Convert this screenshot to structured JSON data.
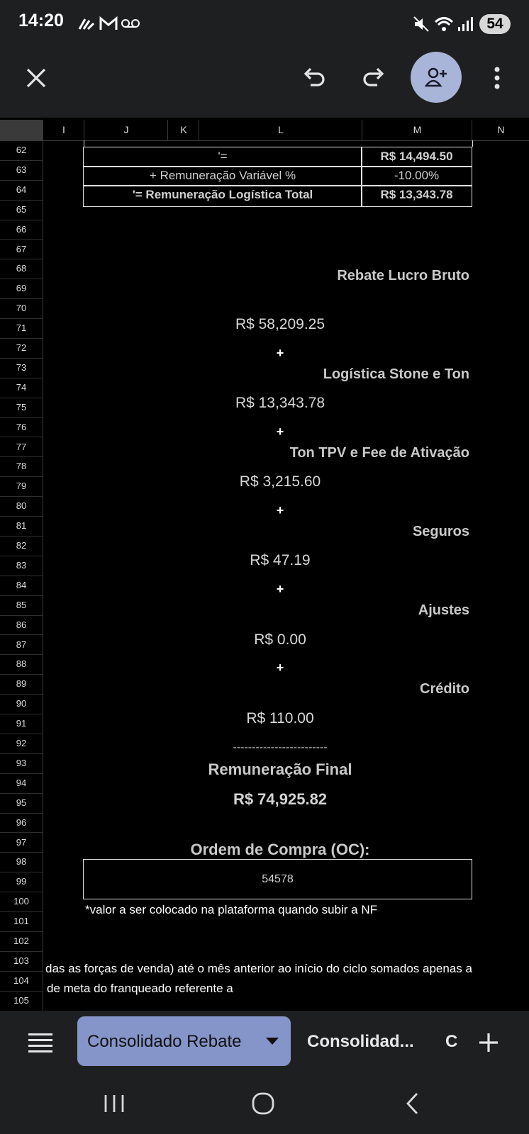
{
  "status_bar": {
    "time": "14:20",
    "left_icons": [
      "signal-app-icon",
      "gmail-icon",
      "voicemail-icon"
    ],
    "right_icons": [
      "mute-icon",
      "wifi-icon",
      "cell-signal-icon"
    ],
    "battery": "54"
  },
  "toolbar": {
    "close_icon": "close-icon",
    "undo_icon": "undo-icon",
    "redo_icon": "redo-icon",
    "share_icon": "add-person-icon",
    "more_icon": "more-vert-icon"
  },
  "columns": [
    "I",
    "J",
    "K",
    "L",
    "M",
    "N"
  ],
  "rows": [
    "62",
    "63",
    "64",
    "65",
    "66",
    "67",
    "68",
    "69",
    "70",
    "71",
    "72",
    "73",
    "74",
    "75",
    "76",
    "77",
    "78",
    "79",
    "80",
    "81",
    "82",
    "83",
    "84",
    "85",
    "86",
    "87",
    "88",
    "89",
    "90",
    "91",
    "92",
    "93",
    "94",
    "95",
    "96",
    "97",
    "98",
    "99",
    "100",
    "101",
    "102",
    "103",
    "104",
    "105"
  ],
  "table": {
    "r62_label": "'=",
    "r62_value": "R$ 14,494.50",
    "r63_label": "+ Remuneração Variável %",
    "r63_value": "-10.00%",
    "r64_label": "'= Remuneração Logística Total",
    "r64_value": "R$ 13,343.78"
  },
  "summary": {
    "h1": "Rebate Lucro Bruto",
    "v1": "R$ 58,209.25",
    "plus": "+",
    "h2": "Logística Stone e Ton",
    "v2": "R$ 13,343.78",
    "h3": "Ton TPV e Fee de Ativação",
    "v3": "R$ 3,215.60",
    "h4": "Seguros",
    "v4": "R$ 47.19",
    "h5": "Ajustes",
    "v5": "R$ 0.00",
    "h6": "Crédito",
    "v6": "R$ 110.00",
    "divider": "-------------------------",
    "final_label": "Remuneração Final",
    "final_value": "R$ 74,925.82",
    "oc_label": "Ordem de Compra (OC):",
    "oc_value": "54578",
    "note": "*valor a ser colocado na plataforma quando subir a NF",
    "r103": "das as forças de venda) até o mês anterior ao início do ciclo somados apenas a",
    "r104": "de meta do franqueado referente a"
  },
  "tabs": {
    "menu_icon": "sheets-list-icon",
    "active": "Consolidado Rebate",
    "second": "Consolidad...",
    "third": "C",
    "add_icon": "add-sheet-icon"
  },
  "nav": [
    "recent-apps-icon",
    "home-icon",
    "back-icon"
  ]
}
